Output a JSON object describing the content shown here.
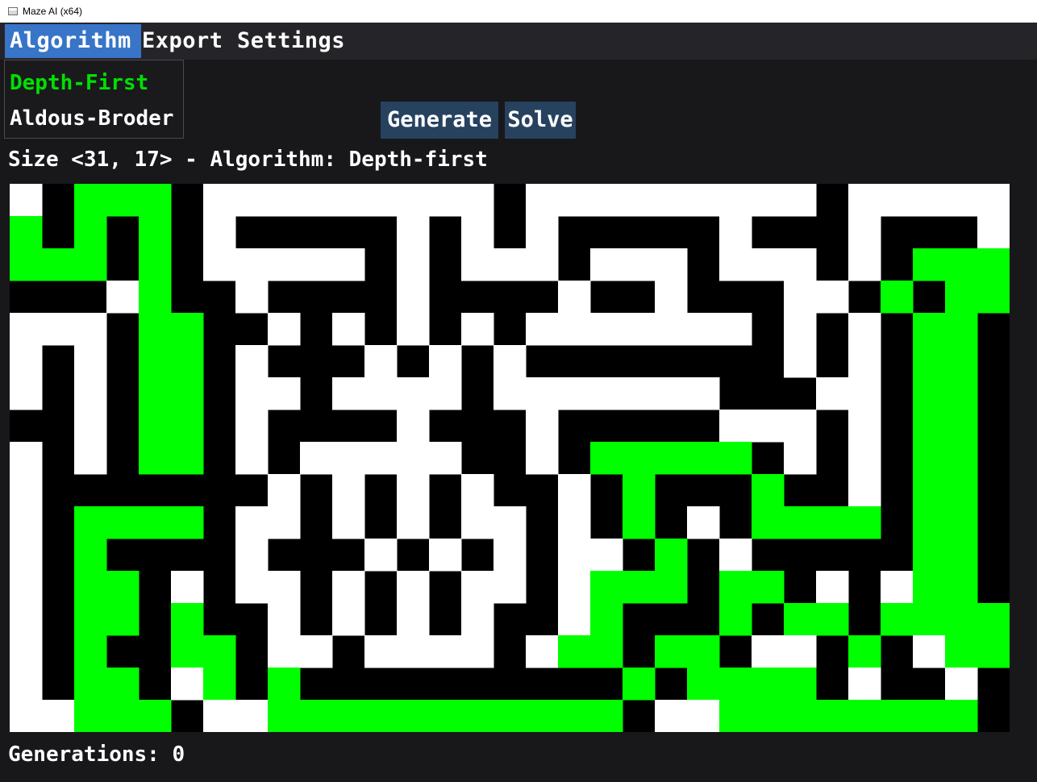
{
  "window": {
    "title": "Maze AI (x64)",
    "icon": "window-app-icon"
  },
  "menu": [
    {
      "label": "Algorithm",
      "active": true
    },
    {
      "label": "Export",
      "active": false
    },
    {
      "label": "Settings",
      "active": false
    }
  ],
  "algorithm_dropdown": {
    "items": [
      {
        "label": "Depth-First",
        "selected": true
      },
      {
        "label": "Aldous-Broder",
        "selected": false
      }
    ]
  },
  "buttons": {
    "generate_label": "Generate",
    "solve_label": "Solve"
  },
  "info": {
    "line": "Size <31, 17> - Algorithm: Depth-first"
  },
  "status": {
    "generations": "Generations: 0"
  },
  "colors": {
    "wall": "#000000",
    "passage": "#ffffff",
    "solution_path": "#00ff00",
    "menu_active": "#3874c8",
    "button": "#27425f",
    "selected_item": "#00e000"
  },
  "maze": {
    "columns": 31,
    "rows": 17,
    "legend": {
      "#": "wall",
      ".": "passage",
      "o": "solution_path"
    },
    "grid": [
      ".#ooo#.........#.........#.....",
      "o#o#o#.#####.#.#.#####.###.###.",
      "ooo#o#.....#.#...#...#...#.#ooo",
      "###.o##.####.####.##.###..#o#oo",
      "...#oo##.#.#.#.#.......#.#.#oo",
      ".#.#oo#.###.#.#.########.#.#oo",
      ".#.#oo#..#....#.......###..#oo",
      "##.#oo#.####.###.#####...#.#oo",
      ".#.#oo#.#.....##.#ooooo#.#.#oo",
      ".#######.#.#.#.##.#o###o##.#oo",
      ".#oooo#..#.#.#..#.#o#.#oooo#oo",
      ".#o####.###.#.#.#..#o#.#####oo",
      ".#oo#.#..#.#.#..#.ooo#oo#.#.oo",
      ".#oo#o##.#.#.#.##.o###o#oo#oooo",
      ".#o##oo#..#....#.oo#oo#..#o#.oo",
      ".#oo#.o#o##########o#oooo#.##.",
      "..ooo#..ooooooooooo#..oooooooo"
    ]
  }
}
